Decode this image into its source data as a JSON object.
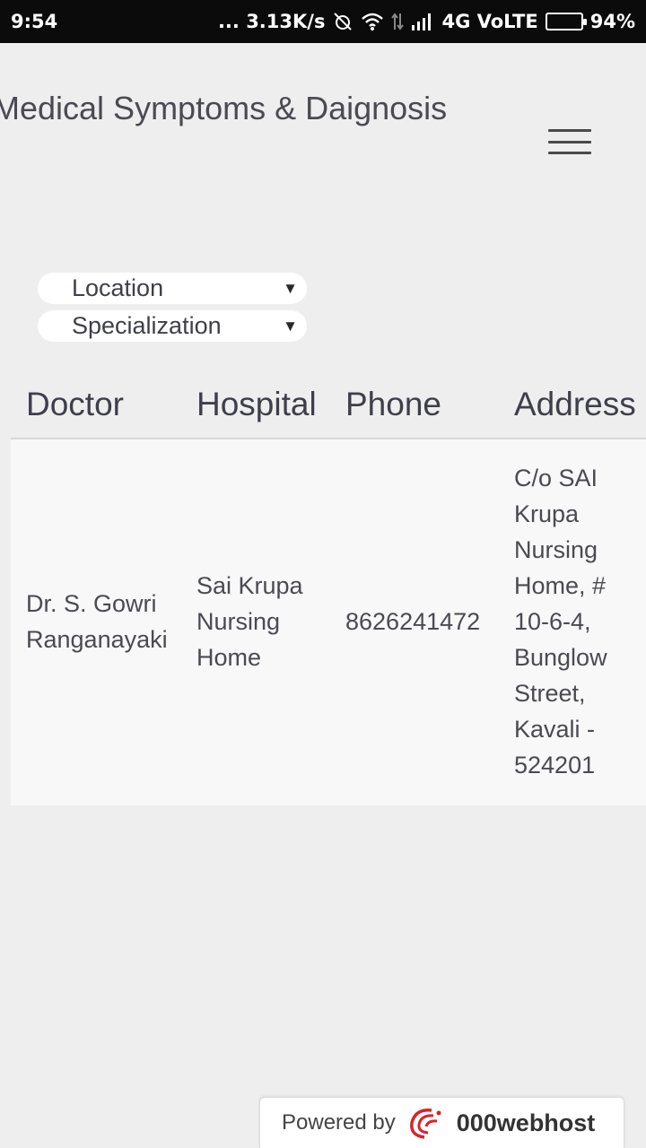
{
  "status_bar": {
    "time": "9:54",
    "network_speed": "... 3.13K/s",
    "network_type": "4G VoLTE",
    "battery": "94%",
    "battery_level": 0.94
  },
  "header": {
    "title": "Medical Symptoms & Daignosis",
    "menu_icon": "hamburger-icon"
  },
  "filters": {
    "location": {
      "selected": "Location"
    },
    "specialization": {
      "selected": "Specialization"
    }
  },
  "table": {
    "columns": [
      "Doctor",
      "Hospital",
      "Phone",
      "Address"
    ],
    "rows": [
      {
        "doctor": [
          "Dr. S. Gowri",
          "Ranganayaki"
        ],
        "hospital": [
          "Sai Krupa",
          "Nursing",
          "Home"
        ],
        "phone": "8626241472",
        "address": [
          "C/o SAI",
          "Krupa",
          "Nursing",
          "Home, #",
          "10-6-4,",
          "Bunglow",
          "Street,",
          "Kavali -",
          "524201"
        ]
      }
    ]
  },
  "footer": {
    "powered_by": "Powered by",
    "brand": "000webhost",
    "brand_color": "#d8232a"
  }
}
